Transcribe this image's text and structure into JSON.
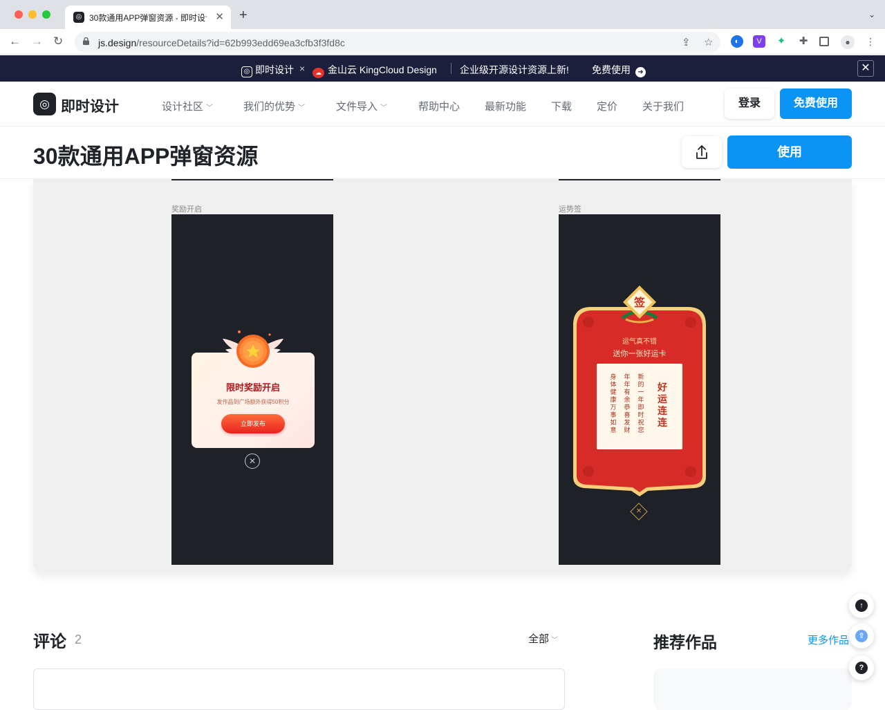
{
  "browser": {
    "tab_title": "30款通用APP弹窗资源 - 即时设计",
    "url_host": "js.design",
    "url_path": "/resourceDetails?id=62b993edd69ea3cfb3f3fd8c",
    "icons": [
      "back-icon",
      "forward-icon",
      "reload-icon",
      "lock-icon",
      "share-icon",
      "star-icon",
      "extension-icon",
      "sidebar-icon",
      "profile-icon",
      "menu-icon"
    ]
  },
  "banner": {
    "brand1": "即时设计",
    "times": "×",
    "brand2": "金山云 KingCloud Design",
    "message": "企业级开源设计资源上新!",
    "cta": "免费使用"
  },
  "header": {
    "logo": "即时设计",
    "nav": [
      {
        "label": "设计社区",
        "dropdown": true
      },
      {
        "label": "我们的优势",
        "dropdown": true
      },
      {
        "label": "文件导入",
        "dropdown": true
      },
      {
        "label": "帮助中心",
        "dropdown": false
      },
      {
        "label": "最新功能",
        "dropdown": false
      },
      {
        "label": "下载",
        "dropdown": false
      },
      {
        "label": "定价",
        "dropdown": false
      },
      {
        "label": "关于我们",
        "dropdown": false
      }
    ],
    "login": "登录",
    "free": "免费使用"
  },
  "title_row": {
    "title": "30款通用APP弹窗资源",
    "use": "使用"
  },
  "preview": {
    "frame1": {
      "label": "奖励开启",
      "title": "限时奖励开启",
      "subtitle": "发作品到广场额外获得50积分",
      "button": "立即发布"
    },
    "frame2": {
      "label": "运势签",
      "badge": "签",
      "line1": "运气真不错",
      "line2": "送你一张好运卡",
      "columns": [
        "身体健康 万事如意",
        "年年有余 恭喜发财",
        "新的一年 即时祝您"
      ],
      "big": "好运连连"
    }
  },
  "comments": {
    "title": "评论",
    "count": "2",
    "filter": "全部"
  },
  "recommend": {
    "title": "推荐作品",
    "more": "更多作品"
  },
  "colors": {
    "accent": "#0c94f4",
    "banner_bg": "#1b1f3b",
    "frame_bg": "#1e2127",
    "fortune_red": "#d62b27"
  }
}
